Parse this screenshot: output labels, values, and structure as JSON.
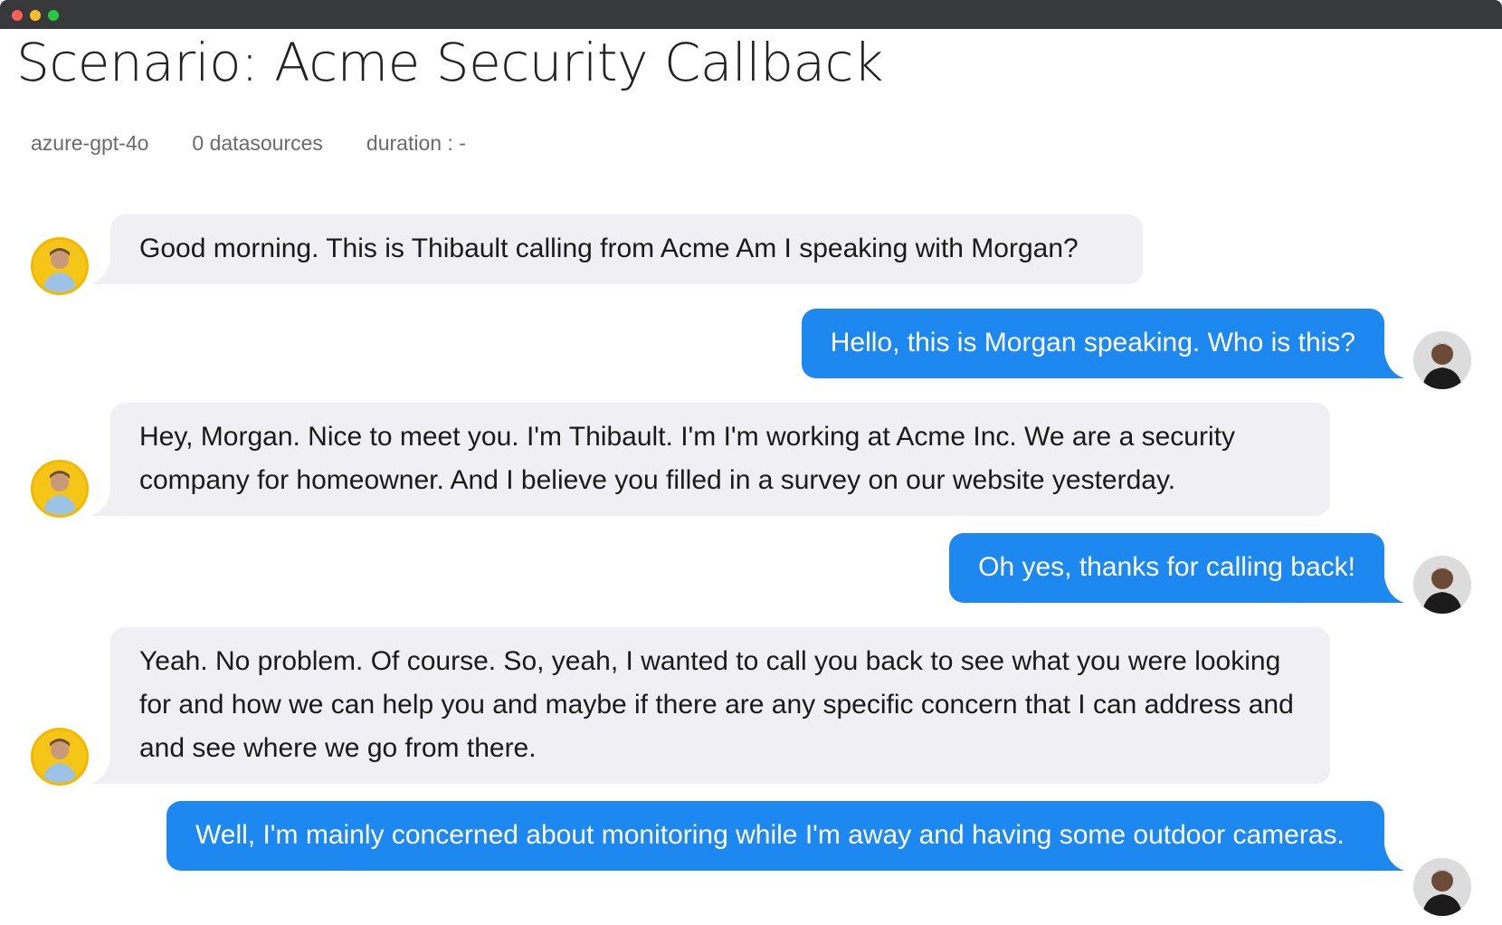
{
  "window": {
    "title": ""
  },
  "page": {
    "title": "Scenario: Acme Security Callback"
  },
  "meta": {
    "model": "azure-gpt-4o",
    "datasources": "0 datasources",
    "duration": "duration : -"
  },
  "colors": {
    "agent_bubble": "#f0f0f4",
    "user_bubble": "#1d89f0",
    "agent_avatar_ring": "#f3b800"
  },
  "messages": [
    {
      "role": "agent",
      "text": "Good morning. This is Thibault calling from Acme Am I speaking with Morgan?"
    },
    {
      "role": "user",
      "text": "Hello, this is Morgan speaking. Who is this?"
    },
    {
      "role": "agent",
      "text": "Hey, Morgan. Nice to meet you. I'm Thibault. I'm I'm working at Acme Inc. We are a security company for homeowner. And I believe you filled in a survey on our website yesterday."
    },
    {
      "role": "user",
      "text": "Oh yes, thanks for calling back!"
    },
    {
      "role": "agent",
      "text": "Yeah. No problem. Of course. So, yeah, I wanted to call you back to see what you were looking for and how we can help you and maybe if there are any specific concern that I can address and and see where we go from there."
    },
    {
      "role": "user",
      "text": "Well, I'm mainly concerned about monitoring while I'm away and having some outdoor cameras."
    }
  ]
}
